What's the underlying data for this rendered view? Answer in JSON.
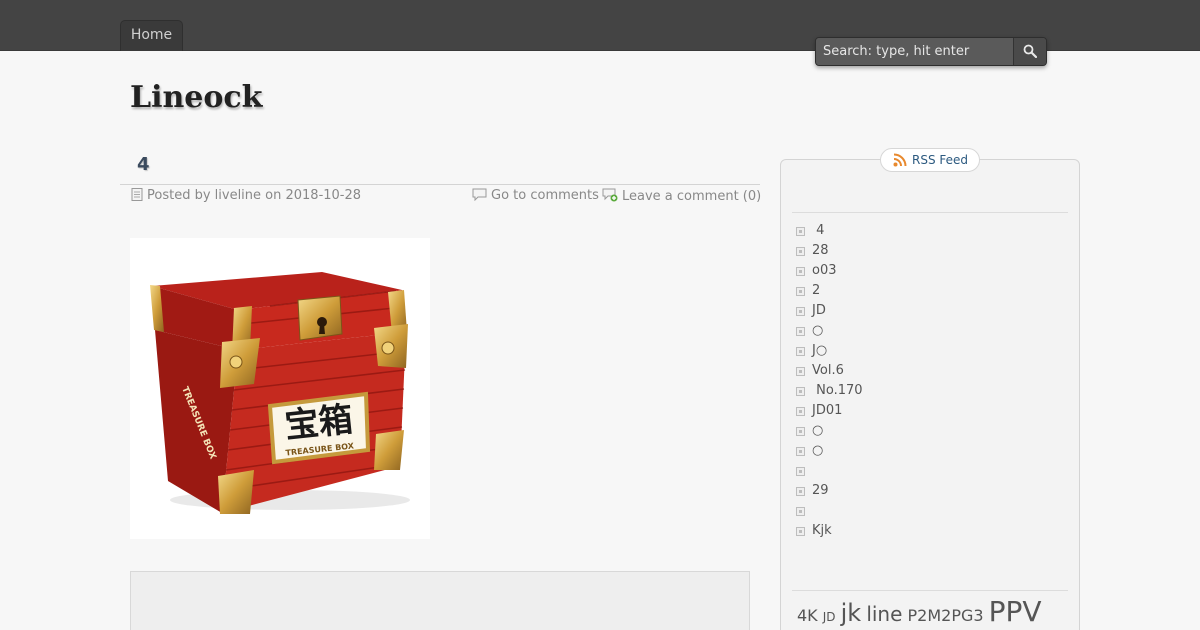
{
  "nav": {
    "home_label": "Home"
  },
  "search": {
    "placeholder": "Search: type, hit enter"
  },
  "site": {
    "title": "Lineock"
  },
  "post": {
    "title": "4",
    "meta_posted": "Posted by liveline on 2018-10-28",
    "meta_comments": "Go to comments",
    "meta_leave": "Leave a comment (0)",
    "image": {
      "kanji": "宝箱",
      "english": "TREASURE BOX",
      "side_text": "TREASURE BOX"
    }
  },
  "sidebar": {
    "rss_label": "RSS Feed",
    "items": [
      " 4",
      "28",
      "o03",
      "2",
      "JD",
      "○",
      "J○",
      "Vol.6",
      " No.170",
      "JD01",
      "○",
      "○",
      "",
      "29",
      "",
      "Kjk"
    ],
    "tags": [
      "4K",
      "JD",
      "jk",
      "line",
      "P2M2PG3",
      "PPV"
    ]
  },
  "colors": {
    "topbar": "#444444",
    "link": "#2c5a80",
    "chest_red": "#c8291e",
    "chest_gold": "#d9ae4a"
  }
}
